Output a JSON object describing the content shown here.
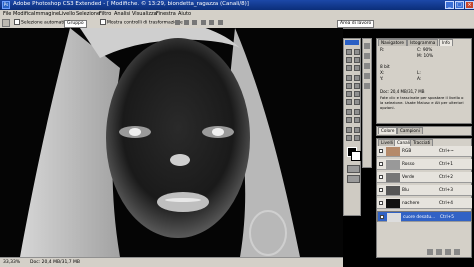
{
  "window": {
    "title": "Adobe Photoshop CS3 Extended - [ Modifiche. © 13:29, biondetta_ragazza (Canali/8)]",
    "app_icon": "Ps",
    "minimize_icon": "minimize-icon",
    "maximize_icon": "maximize-icon",
    "close_icon": "close-icon"
  },
  "menu": {
    "items": [
      "File",
      "Modifica",
      "Immagine",
      "Livello",
      "Selezione",
      "Filtro",
      "Analisi",
      "Visualizza",
      "Finestra",
      "Aiuto"
    ]
  },
  "options": {
    "auto_select_label": "Selezione automatica:",
    "auto_select_value": "Gruppo",
    "transform_label": "Mostra controlli di trasformazione",
    "workspace_label": "Area di lavoro"
  },
  "nav_panel": {
    "tabs": [
      "Navigatore",
      "Istogramma",
      "Info"
    ],
    "r_label": "R:",
    "c_label": "C:",
    "c_value": "90%",
    "m_label": "M:",
    "m_value": "10%",
    "x_label": "X:",
    "y_label": "Y:",
    "w_label": "L:",
    "h_label": "A:",
    "bit_label": "8 bit",
    "doc_info": "Doc: 20,4 MB/31,7 MB",
    "hint": "Fate clic e trascinate per spostare il livello o la selezione. Usate Maiusc e Alt per ulteriori opzioni."
  },
  "colors_panel": {
    "tabs": [
      "Colore",
      "Campioni"
    ]
  },
  "channels_panel": {
    "tabs": [
      "Livelli",
      "Canali",
      "Tracciati"
    ],
    "rows": [
      {
        "name": "RGB",
        "key": "Ctrl+~"
      },
      {
        "name": "Rosso",
        "key": "Ctrl+1"
      },
      {
        "name": "Verde",
        "key": "Ctrl+2"
      },
      {
        "name": "Blu",
        "key": "Ctrl+3"
      },
      {
        "name": "nachere",
        "key": "Ctrl+4"
      },
      {
        "name": "cuore desatu...",
        "key": "Ctrl+5"
      }
    ]
  },
  "status": {
    "zoom": "33,33%",
    "doc": "Doc: 20,4 MB/31,7 MB"
  },
  "colors": {
    "titlebar": "#0b2e7a",
    "selection": "#3162c5"
  }
}
